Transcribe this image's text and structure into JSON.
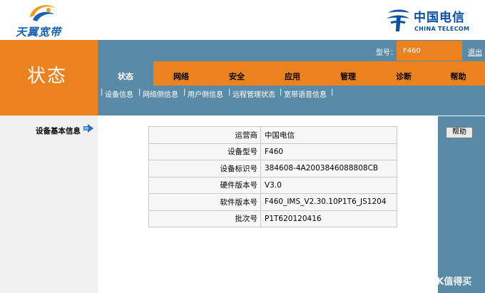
{
  "brand": {
    "left_logo_text": "天翼宽带",
    "right_logo_cn": "中国电信",
    "right_logo_en": "CHINA TELECOM"
  },
  "header": {
    "section_title": "状态",
    "model_label": "型号：",
    "model_value": "F460",
    "logout_label": "退出"
  },
  "tabs": [
    {
      "label": "状态",
      "active": true
    },
    {
      "label": "网络",
      "active": false
    },
    {
      "label": "安全",
      "active": false
    },
    {
      "label": "应用",
      "active": false
    },
    {
      "label": "管理",
      "active": false
    },
    {
      "label": "诊断",
      "active": false
    },
    {
      "label": "帮助",
      "active": false
    }
  ],
  "subnav": [
    "设备信息",
    "网络侧信息",
    "用户侧信息",
    "远程管理状态",
    "宽带语音信息"
  ],
  "sidebar": {
    "item_label": "设备基本信息"
  },
  "device_info": [
    {
      "label": "运营商",
      "value": "中国电信"
    },
    {
      "label": "设备型号",
      "value": "F460"
    },
    {
      "label": "设备标识号",
      "value": "384608-4A2003846088808CB"
    },
    {
      "label": "硬件版本号",
      "value": "V3.0"
    },
    {
      "label": "软件版本号",
      "value": "F460_IMS_V2.30.10P1T6_JS1204"
    },
    {
      "label": "批次号",
      "value": "P1T620120416"
    }
  ],
  "help_button_label": "帮助",
  "watermark": "SMK值得买",
  "colors": {
    "orange": "#ec821e",
    "steel_blue": "#5a8ba6",
    "logo_blue": "#0b4fa2"
  }
}
